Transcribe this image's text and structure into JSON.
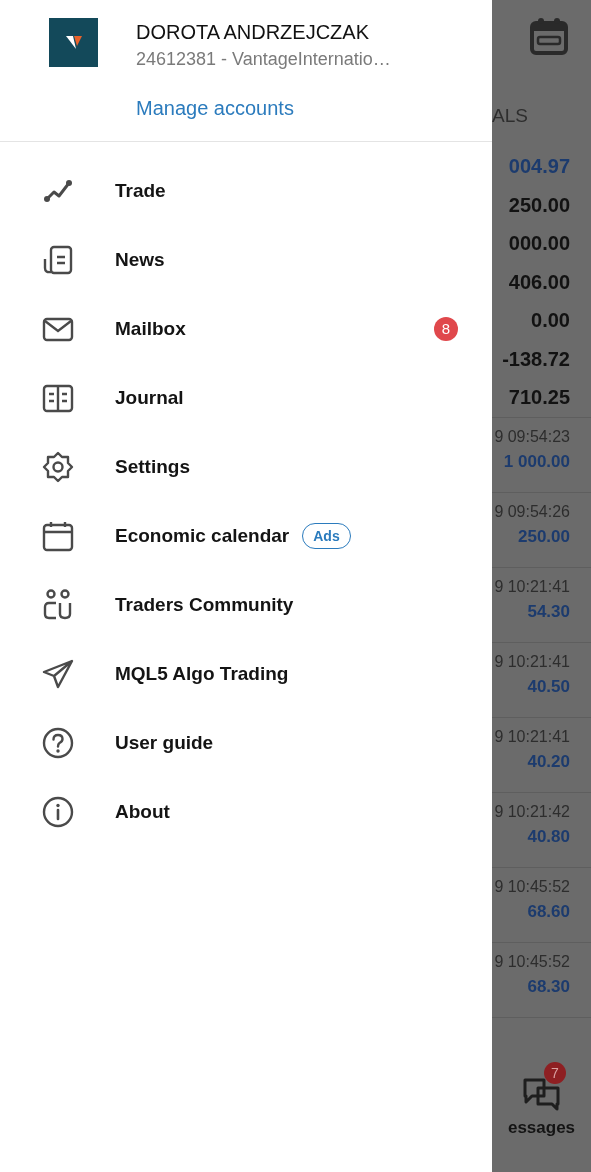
{
  "account": {
    "name": "DOROTA ANDRZEJCZAK",
    "details": "24612381 - VantageInternatio…",
    "manage_link": "Manage accounts"
  },
  "menu": [
    {
      "label": "Trade"
    },
    {
      "label": "News"
    },
    {
      "label": "Mailbox",
      "badge": "8"
    },
    {
      "label": "Journal"
    },
    {
      "label": "Settings"
    },
    {
      "label": "Economic calendar",
      "tag": "Ads"
    },
    {
      "label": "Traders Community"
    },
    {
      "label": "MQL5 Algo Trading"
    },
    {
      "label": "User guide"
    },
    {
      "label": "About"
    }
  ],
  "background": {
    "column_header": "ALS",
    "summary_values": [
      {
        "value": "004.97",
        "kind": "highlight"
      },
      {
        "value": "250.00",
        "kind": "plain"
      },
      {
        "value": "000.00",
        "kind": "plain"
      },
      {
        "value": "406.00",
        "kind": "plain"
      },
      {
        "value": "0.00",
        "kind": "plain"
      },
      {
        "value": "-138.72",
        "kind": "plain"
      },
      {
        "value": "710.25",
        "kind": "plain"
      }
    ],
    "deals": [
      {
        "time": "9 09:54:23",
        "amount": "1 000.00"
      },
      {
        "time": "9 09:54:26",
        "amount": "250.00"
      },
      {
        "time": "9 10:21:41",
        "amount": "54.30"
      },
      {
        "time": "9 10:21:41",
        "amount": "40.50"
      },
      {
        "time": "9 10:21:41",
        "amount": "40.20"
      },
      {
        "time": "9 10:21:42",
        "amount": "40.80"
      },
      {
        "time": "9 10:45:52",
        "amount": "68.60"
      },
      {
        "time": "9 10:45:52",
        "amount": "68.30"
      }
    ],
    "bottom_tab": {
      "label": "essages",
      "badge": "7"
    }
  }
}
